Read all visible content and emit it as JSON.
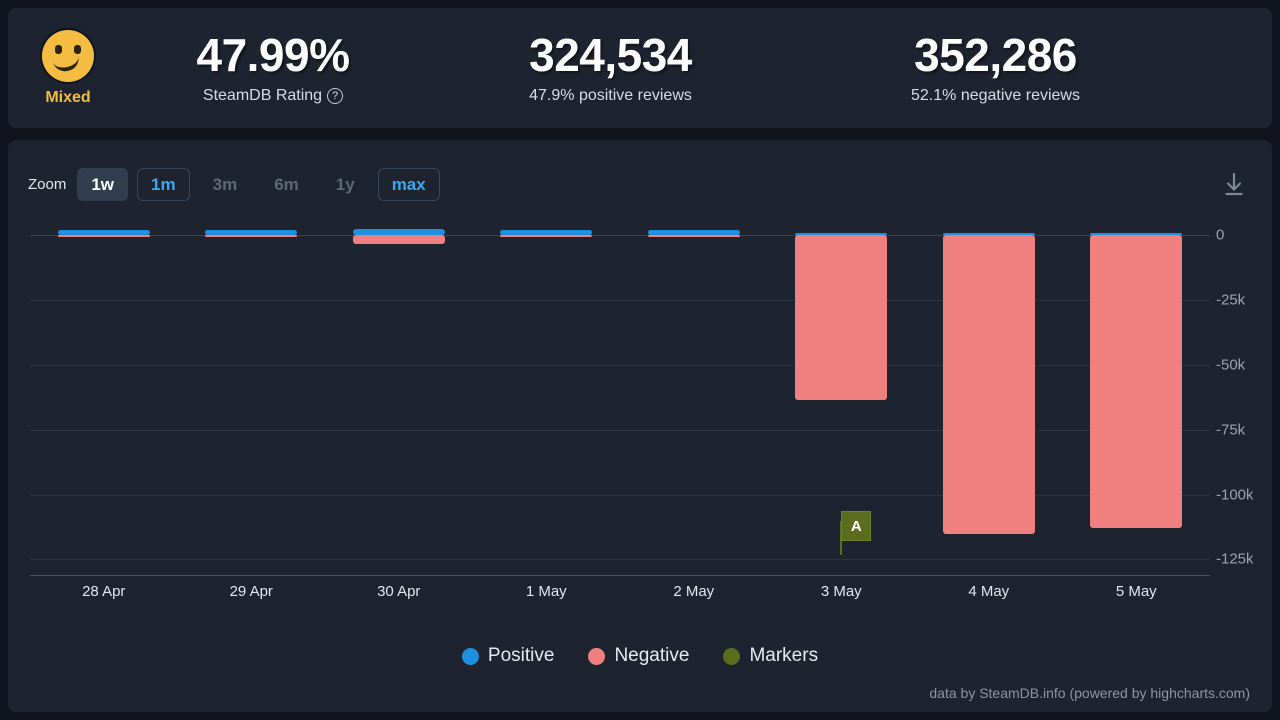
{
  "header": {
    "rating_face_icon": "confused-face-icon",
    "rating_label": "Mixed",
    "rating_color": "#f5bc42",
    "score_value": "47.99%",
    "score_label": "SteamDB Rating",
    "help_icon": "question-mark-icon",
    "positive_value": "324,534",
    "positive_label": "47.9% positive reviews",
    "negative_value": "352,286",
    "negative_label": "52.1% negative reviews"
  },
  "chart_controls": {
    "zoom_label": "Zoom",
    "buttons": [
      {
        "label": "1w",
        "state": "active"
      },
      {
        "label": "1m",
        "state": "outlined"
      },
      {
        "label": "3m",
        "state": "plain"
      },
      {
        "label": "6m",
        "state": "plain"
      },
      {
        "label": "1y",
        "state": "plain"
      },
      {
        "label": "max",
        "state": "outlined"
      }
    ],
    "download_icon": "download-icon"
  },
  "credits": "data by SteamDB.info (powered by highcharts.com)",
  "colors": {
    "positive": "#1f8fe0",
    "negative": "#f07f7f",
    "markers": "#5c6b1e",
    "panel": "#1d2430",
    "background": "#10131c"
  },
  "chart_data": {
    "type": "bar",
    "title": "",
    "xlabel": "",
    "ylabel": "",
    "grid": true,
    "legend_position": "bottom",
    "categories": [
      "28 Apr",
      "29 Apr",
      "30 Apr",
      "1 May",
      "2 May",
      "3 May",
      "4 May",
      "5 May"
    ],
    "yticks": [
      "0",
      "-25k",
      "-50k",
      "-75k",
      "-100k",
      "-125k"
    ],
    "ytick_values": [
      0,
      -25000,
      -50000,
      -75000,
      -100000,
      -125000
    ],
    "ylim": [
      -131000,
      4000
    ],
    "series": [
      {
        "name": "Positive",
        "color": "#1f8fe0",
        "values": [
          2100,
          2000,
          2300,
          1900,
          2000,
          900,
          300,
          300
        ]
      },
      {
        "name": "Negative",
        "color": "#f07f7f",
        "values": [
          -200,
          -150,
          -3200,
          -200,
          -250,
          -63500,
          -115000,
          -113000
        ]
      }
    ],
    "markers": [
      {
        "label": "A",
        "category": "3 May",
        "color": "#5c6b1e"
      }
    ],
    "legend": [
      {
        "label": "Positive",
        "color": "#1f8fe0"
      },
      {
        "label": "Negative",
        "color": "#f07f7f"
      },
      {
        "label": "Markers",
        "color": "#5c6b1e"
      }
    ]
  }
}
